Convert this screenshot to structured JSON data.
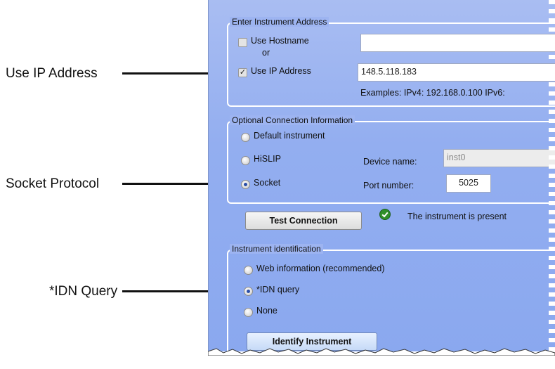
{
  "callouts": {
    "ip": "Use IP Address",
    "socket": "Socket Protocol",
    "idn": "*IDN Query"
  },
  "address_group": {
    "legend": "Enter Instrument Address",
    "use_hostname": "Use Hostname",
    "use_hostname_checked": false,
    "or_text": "or",
    "use_ip": "Use IP Address",
    "use_ip_checked": true,
    "hostname_value": "",
    "ip_value": "148.5.118.183",
    "examples": "Examples: IPv4: 192.168.0.100   IPv6:"
  },
  "optional_group": {
    "legend": "Optional Connection Information",
    "default_instrument": "Default instrument",
    "hislip": "HiSLIP",
    "socket": "Socket",
    "selected": "Socket",
    "device_name_label": "Device name:",
    "device_name_value": "inst0",
    "port_label": "Port number:",
    "port_value": "5025"
  },
  "test": {
    "button": "Test Connection",
    "status": "The instrument is present",
    "status_icon": "green-check-icon"
  },
  "ident_group": {
    "legend": "Instrument identification",
    "web": "Web information (recommended)",
    "idn": "*IDN query",
    "none": "None",
    "selected": "*IDN query",
    "identify_button": "Identify Instrument"
  }
}
